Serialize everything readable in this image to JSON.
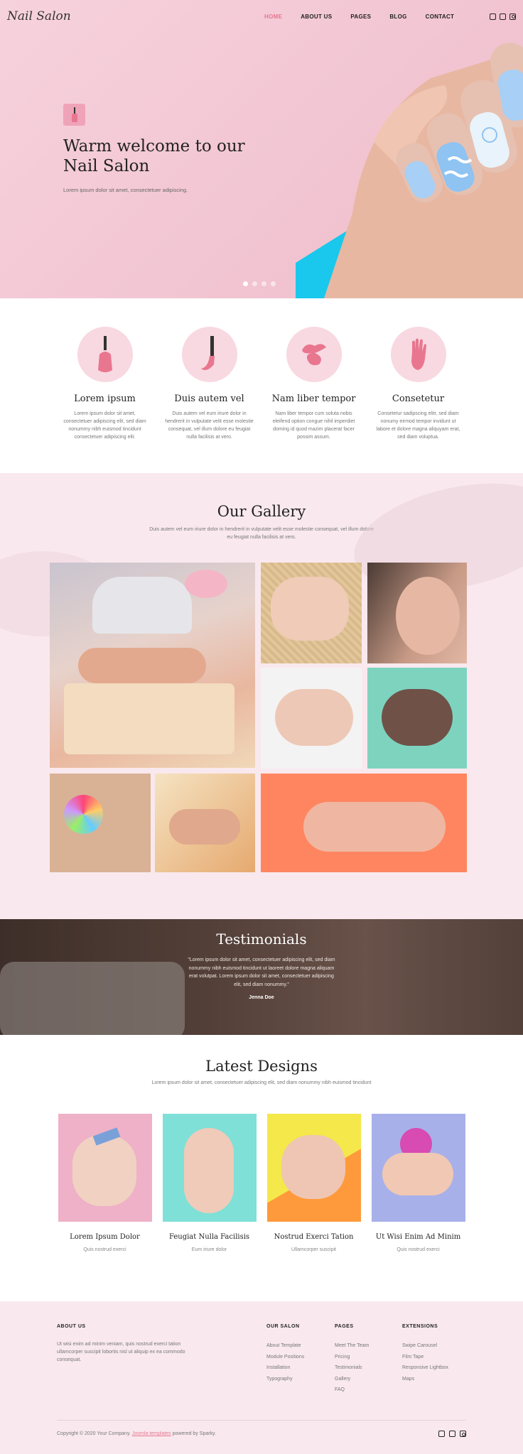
{
  "header": {
    "logo": "Nail Salon",
    "nav": [
      "HOME",
      "ABOUT US",
      "PAGES",
      "BLOG",
      "CONTACT"
    ],
    "social": [
      "facebook-icon",
      "twitter-icon",
      "instagram-icon"
    ]
  },
  "hero": {
    "title": "Warm welcome to our Nail Salon",
    "subtitle": "Lorem ipsum dolor sit amet, consectetuer adipiscing.",
    "slides": 4,
    "active_slide": 1
  },
  "features": [
    {
      "title": "Lorem ipsum",
      "text": "Lorem ipsum dolor sit amet, consectetuer adipiscing elit, sed diam nonummy nibh euismod tincidunt consectetuer adipiscing elit.",
      "icon": "nail-polish-icon"
    },
    {
      "title": "Duis autem vel",
      "text": "Duis autem vel eum iriure dolor in hendrerit in vulputate velit esse molestie consequat, vel illum dolore eu feugiat nulla facilisis at vero.",
      "icon": "brush-icon"
    },
    {
      "title": "Nam liber tempor",
      "text": "Nam liber tempor cum soluta nobis eleifend option congue nihil imperdiet doming id quod mazim placerat facer possim assum.",
      "icon": "polish-drop-icon"
    },
    {
      "title": "Consetetur",
      "text": "Consetetur sadipscing elitr, sed diam nonumy eirmod tempor invidunt ut labore et dolore magna aliquyam erat, sed diam voluptua.",
      "icon": "hand-icon"
    }
  ],
  "gallery": {
    "title": "Our Gallery",
    "description": "Duis autem vel eum iriure dolor in hendrerit in vulputate velit esse molestie consequat, vel illum dolore eu feugiat nulla facilisis at vero."
  },
  "testimonials": {
    "title": "Testimonials",
    "quote": "\"Lorem ipsum dolor sit amet, consectetuer adipiscing elit, sed diam nonummy nibh euismod tincidunt ut laoreet dolore magna aliquam erat volutpat. Lorem ipsum dolor sit amet, consectetuer adipiscing elit, sed diam nonummy.\"",
    "author": "Jenna Doe"
  },
  "latest": {
    "title": "Latest Designs",
    "description": "Lorem ipsum dolor sit amet, consectetuer adipiscing elit, sed diam nonummy nibh euismod tincidunt",
    "items": [
      {
        "title": "Lorem Ipsum Dolor",
        "sub": "Quis nostrud exerci"
      },
      {
        "title": "Feugiat Nulla Facilisis",
        "sub": "Eum iriure dolor"
      },
      {
        "title": "Nostrud Exerci Tation",
        "sub": "Ullamcorper suscipit"
      },
      {
        "title": "Ut Wisi Enim Ad Minim",
        "sub": "Quis nostrud exerci"
      }
    ]
  },
  "footer": {
    "about_title": "ABOUT US",
    "about_text": "Ut wisi enim ad minim veniam, quis nostrud exerci tation ullamcorper suscipit lobortis nisl ut aliquip ex ea commodo consequat.",
    "our_salon_title": "OUR SALON",
    "our_salon": [
      "About Template",
      "Module Positions",
      "Installation",
      "Typography"
    ],
    "pages_title": "PAGES",
    "pages": [
      "Meet The Team",
      "Pricing",
      "Testimonials",
      "Gallery",
      "FAQ"
    ],
    "extensions_title": "EXTENSIONS",
    "extensions": [
      "Swipe Carousel",
      "Film Tape",
      "Responsive Lightbox",
      "Maps"
    ],
    "copyright_pre": "Copyright © 2020 Your Company.",
    "copyright_link": "Joomla templates",
    "copyright_post": "powered by Sparky."
  },
  "colors": {
    "accent": "#e8768f",
    "pink_bg": "#f9e9ee",
    "hero_pink": "#f3c7d3",
    "hero_blue": "#19c8ec"
  }
}
